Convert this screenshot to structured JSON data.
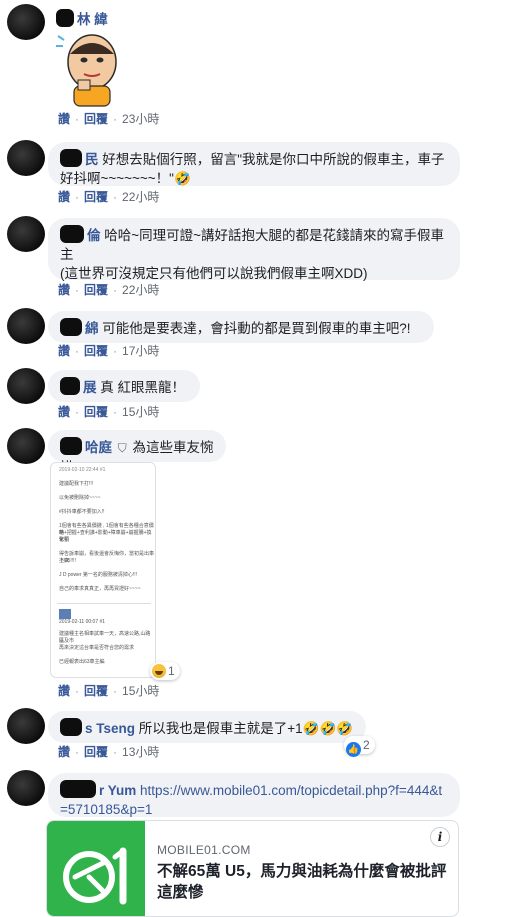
{
  "common": {
    "read_label": "讚",
    "reply_label": "回覆"
  },
  "comments": [
    {
      "author_visible": "林 緯",
      "text": "",
      "time": "23小時"
    },
    {
      "author_visible": "民",
      "text": "好想去貼個行照，留言\"我就是你口中所說的假車主，車子好抖啊~~~~~~~！\"🤣",
      "time": "22小時"
    },
    {
      "author_visible": "倫",
      "text": "哈哈~同理可證~講好話抱大腿的都是花錢請來的寫手假車主",
      "text2": "(這世界可沒規定只有他們可以說我們假車主啊XDD)",
      "time": "22小時"
    },
    {
      "author_visible": "綿",
      "text": "可能他是要表達，會抖動的都是買到假車的車主吧?!",
      "time": "17小時"
    },
    {
      "author_visible": "展",
      "text": "真 紅眼黑龍！",
      "time": "15小時"
    },
    {
      "author_visible": "哈庭",
      "text": "為這些車友惋惜",
      "time": "15小時",
      "reaction_count": "1"
    },
    {
      "author_visible": "s Tseng",
      "text": "所以我也是假車主就是了+1🤣🤣🤣",
      "time": "13小時",
      "reaction_count": "2"
    },
    {
      "author_visible": "r Yum",
      "text": "https://www.mobile01.com/topicdetail.php?f=444&t=5710185&p=1",
      "time": ""
    }
  ],
  "preview": {
    "domain": "MOBILE01.COM",
    "title": "不解65萬 U5，馬力與油耗為什麼會被批評這麼慘",
    "info_icon": "i"
  },
  "screenshot_text": {
    "header": "2019-02-10 22:44 #1",
    "lines": [
      "建議配我下打!!!",
      "以免被刪除掉~~~~",
      "#抖抖車都不要加入!!",
      "1個會有些各異價錢 , 1個會有些各種合意價格",
      "時+把握+查利誰+影動+障車崩+崩握腸+換化引",
      "擎類",
      "得告訴車崩，看後還會反悔你，當初是出車不真",
      "上U5!!!!",
      "J D power 第一名的服務被清掉心!!!",
      "自己的車求真真正，再再買證好~~~~"
    ],
    "footer_lines": [
      "2019-02-11 00:07 #1",
      "建議種主名相車試車一天，高速公路,山路以及市",
      "區",
      "再來決定這台車是否符合您的需求",
      "已經報表出63車主編"
    ]
  },
  "colors": {
    "author": "#385898",
    "bubble": "#f0f2f5",
    "logo_green": "#2fb34a",
    "like_blue": "#1877f2"
  }
}
